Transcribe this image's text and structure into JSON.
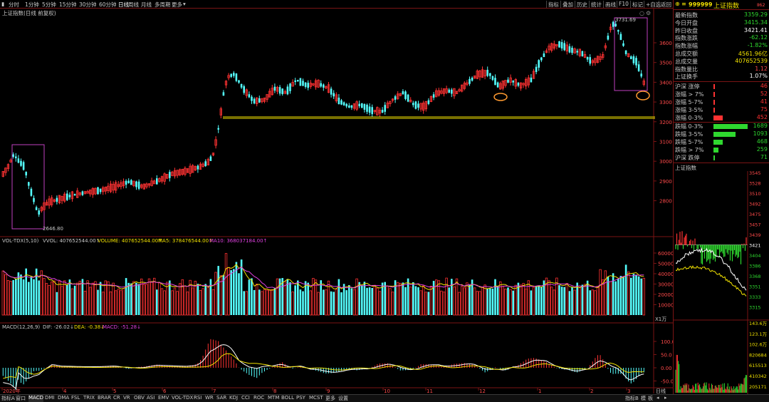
{
  "toolbar": {
    "periods": [
      "分时",
      "1分钟",
      "5分钟",
      "15分钟",
      "30分钟",
      "60分钟",
      "日线",
      "周线",
      "月线",
      "多周期",
      "更多"
    ],
    "active_period": "日线",
    "right_buttons": [
      "指标",
      "叠加",
      "历史",
      "统计",
      "画线",
      "F10",
      "标记",
      "+自选",
      "返回"
    ]
  },
  "main_chart": {
    "title": "上证指数(日线 前复权)",
    "high_label": "3731.69",
    "low_label": "2646.80",
    "price_ticks": [
      "3600",
      "3500",
      "3400",
      "3300",
      "3200",
      "3100",
      "3000",
      "2900",
      "2800"
    ],
    "colors": {
      "up": "#ff3232",
      "down": "#54fcfc",
      "support_line": "#f0e000",
      "box": "#c040c0",
      "circle": "#ff9a30"
    }
  },
  "volume_chart": {
    "legend": {
      "prefix": "VOL-TDX(5,10)",
      "vvol": "VVOL: 407652544.00↑",
      "volume": "VOLUME: 407652544.00↑",
      "ma5": "MA5: 378476544.00↑",
      "ma10": "MA10: 368037184.00↑"
    },
    "ticks": [
      "60000",
      "50000",
      "40000",
      "30000",
      "20000",
      "10000"
    ],
    "unit": "X1万"
  },
  "macd_chart": {
    "legend": {
      "prefix": "MACD(12,26,9)",
      "dif": "DIF: -26.02↓",
      "dea": "DEA: -0.38↓",
      "macd": "MACD: -51.28↓"
    },
    "ticks": [
      "100.0",
      "50.0",
      "0.00",
      "-50.0"
    ],
    "date_labels": [
      "2020年",
      "4",
      "5",
      "6",
      "7",
      "8",
      "9",
      "10",
      "11",
      "12",
      "1",
      "2",
      "3"
    ],
    "bottom_right": "日线"
  },
  "bottom_tabs": [
    "指标A",
    "窗口",
    "MACD",
    "DMI",
    "DMA",
    "FSL",
    "TRIX",
    "BRAR",
    "CR",
    "VR",
    "OBV",
    "ASI",
    "EMV",
    "VOL-TDX",
    "RSI",
    "WR",
    "SAR",
    "KDJ",
    "CCI",
    "ROC",
    "MTM",
    "BOLL",
    "PSY",
    "MCST",
    "更多",
    "设置"
  ],
  "bottom_right_tabs": [
    "指标B",
    "模",
    "板"
  ],
  "quote_panel": {
    "code": "999999",
    "name": "上证指数",
    "badge": "Ⅱ62",
    "rows": [
      {
        "label": "最新指数",
        "value": "3359.29",
        "color": "green"
      },
      {
        "label": "今日开盘",
        "value": "3415.34",
        "color": "green"
      },
      {
        "label": "昨日收盘",
        "value": "3421.41",
        "color": "white"
      },
      {
        "label": "指数涨跌",
        "value": "-62.12",
        "color": "green"
      },
      {
        "label": "指数涨幅",
        "value": "-1.82%",
        "color": "green"
      },
      {
        "label": "总成交额",
        "value": "4561.96亿",
        "color": "yellow"
      },
      {
        "label": "总成交量",
        "value": "407652539",
        "color": "yellow"
      },
      {
        "label": "指数量比",
        "value": "1.12",
        "color": "red"
      },
      {
        "label": "上证换手",
        "value": "1.07%",
        "color": "white"
      }
    ],
    "up_rows": [
      {
        "label": "沪深 涨停",
        "value": "46",
        "fraction": 0.02
      },
      {
        "label": "涨幅 > 7%",
        "value": "52",
        "fraction": 0.03
      },
      {
        "label": "涨幅 5-7%",
        "value": "41",
        "fraction": 0.02
      },
      {
        "label": "涨幅 3-5%",
        "value": "75",
        "fraction": 0.04
      },
      {
        "label": "涨幅 0-3%",
        "value": "452",
        "fraction": 0.27
      }
    ],
    "down_rows": [
      {
        "label": "跌幅 0-3%",
        "value": "1689",
        "fraction": 1.0
      },
      {
        "label": "跌幅 3-5%",
        "value": "1093",
        "fraction": 0.65
      },
      {
        "label": "跌幅 5-7%",
        "value": "468",
        "fraction": 0.28
      },
      {
        "label": "跌幅 > 7%",
        "value": "259",
        "fraction": 0.15
      },
      {
        "label": "沪深 跌停",
        "value": "71",
        "fraction": 0.04
      }
    ]
  },
  "intraday": {
    "title": "上证指数",
    "price_ticks": [
      "3545",
      "3528",
      "3510",
      "3492",
      "3475",
      "3457",
      "3439",
      "3421",
      "3404",
      "3386",
      "3368",
      "3351",
      "3333",
      "3315"
    ],
    "volume_ticks": [
      "143.6万",
      "123.1万",
      "102.6万",
      "820684",
      "615513",
      "410342",
      "205171"
    ]
  }
}
